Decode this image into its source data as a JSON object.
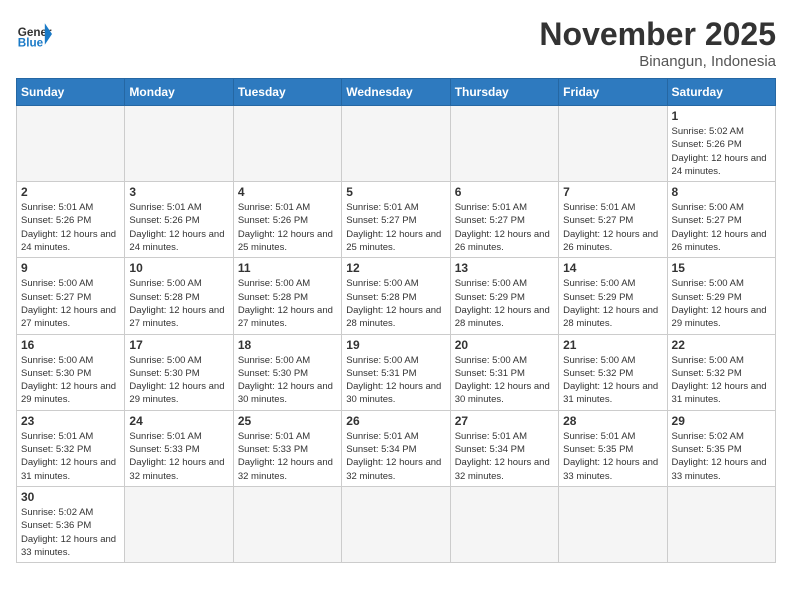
{
  "logo": {
    "text_general": "General",
    "text_blue": "Blue"
  },
  "title": "November 2025",
  "location": "Binangun, Indonesia",
  "weekdays": [
    "Sunday",
    "Monday",
    "Tuesday",
    "Wednesday",
    "Thursday",
    "Friday",
    "Saturday"
  ],
  "days": {
    "1": {
      "sunrise": "5:02 AM",
      "sunset": "5:26 PM",
      "daylight": "12 hours and 24 minutes."
    },
    "2": {
      "sunrise": "5:01 AM",
      "sunset": "5:26 PM",
      "daylight": "12 hours and 24 minutes."
    },
    "3": {
      "sunrise": "5:01 AM",
      "sunset": "5:26 PM",
      "daylight": "12 hours and 24 minutes."
    },
    "4": {
      "sunrise": "5:01 AM",
      "sunset": "5:26 PM",
      "daylight": "12 hours and 25 minutes."
    },
    "5": {
      "sunrise": "5:01 AM",
      "sunset": "5:27 PM",
      "daylight": "12 hours and 25 minutes."
    },
    "6": {
      "sunrise": "5:01 AM",
      "sunset": "5:27 PM",
      "daylight": "12 hours and 26 minutes."
    },
    "7": {
      "sunrise": "5:01 AM",
      "sunset": "5:27 PM",
      "daylight": "12 hours and 26 minutes."
    },
    "8": {
      "sunrise": "5:00 AM",
      "sunset": "5:27 PM",
      "daylight": "12 hours and 26 minutes."
    },
    "9": {
      "sunrise": "5:00 AM",
      "sunset": "5:27 PM",
      "daylight": "12 hours and 27 minutes."
    },
    "10": {
      "sunrise": "5:00 AM",
      "sunset": "5:28 PM",
      "daylight": "12 hours and 27 minutes."
    },
    "11": {
      "sunrise": "5:00 AM",
      "sunset": "5:28 PM",
      "daylight": "12 hours and 27 minutes."
    },
    "12": {
      "sunrise": "5:00 AM",
      "sunset": "5:28 PM",
      "daylight": "12 hours and 28 minutes."
    },
    "13": {
      "sunrise": "5:00 AM",
      "sunset": "5:29 PM",
      "daylight": "12 hours and 28 minutes."
    },
    "14": {
      "sunrise": "5:00 AM",
      "sunset": "5:29 PM",
      "daylight": "12 hours and 28 minutes."
    },
    "15": {
      "sunrise": "5:00 AM",
      "sunset": "5:29 PM",
      "daylight": "12 hours and 29 minutes."
    },
    "16": {
      "sunrise": "5:00 AM",
      "sunset": "5:30 PM",
      "daylight": "12 hours and 29 minutes."
    },
    "17": {
      "sunrise": "5:00 AM",
      "sunset": "5:30 PM",
      "daylight": "12 hours and 29 minutes."
    },
    "18": {
      "sunrise": "5:00 AM",
      "sunset": "5:30 PM",
      "daylight": "12 hours and 30 minutes."
    },
    "19": {
      "sunrise": "5:00 AM",
      "sunset": "5:31 PM",
      "daylight": "12 hours and 30 minutes."
    },
    "20": {
      "sunrise": "5:00 AM",
      "sunset": "5:31 PM",
      "daylight": "12 hours and 30 minutes."
    },
    "21": {
      "sunrise": "5:00 AM",
      "sunset": "5:32 PM",
      "daylight": "12 hours and 31 minutes."
    },
    "22": {
      "sunrise": "5:00 AM",
      "sunset": "5:32 PM",
      "daylight": "12 hours and 31 minutes."
    },
    "23": {
      "sunrise": "5:01 AM",
      "sunset": "5:32 PM",
      "daylight": "12 hours and 31 minutes."
    },
    "24": {
      "sunrise": "5:01 AM",
      "sunset": "5:33 PM",
      "daylight": "12 hours and 32 minutes."
    },
    "25": {
      "sunrise": "5:01 AM",
      "sunset": "5:33 PM",
      "daylight": "12 hours and 32 minutes."
    },
    "26": {
      "sunrise": "5:01 AM",
      "sunset": "5:34 PM",
      "daylight": "12 hours and 32 minutes."
    },
    "27": {
      "sunrise": "5:01 AM",
      "sunset": "5:34 PM",
      "daylight": "12 hours and 32 minutes."
    },
    "28": {
      "sunrise": "5:01 AM",
      "sunset": "5:35 PM",
      "daylight": "12 hours and 33 minutes."
    },
    "29": {
      "sunrise": "5:02 AM",
      "sunset": "5:35 PM",
      "daylight": "12 hours and 33 minutes."
    },
    "30": {
      "sunrise": "5:02 AM",
      "sunset": "5:36 PM",
      "daylight": "12 hours and 33 minutes."
    }
  }
}
